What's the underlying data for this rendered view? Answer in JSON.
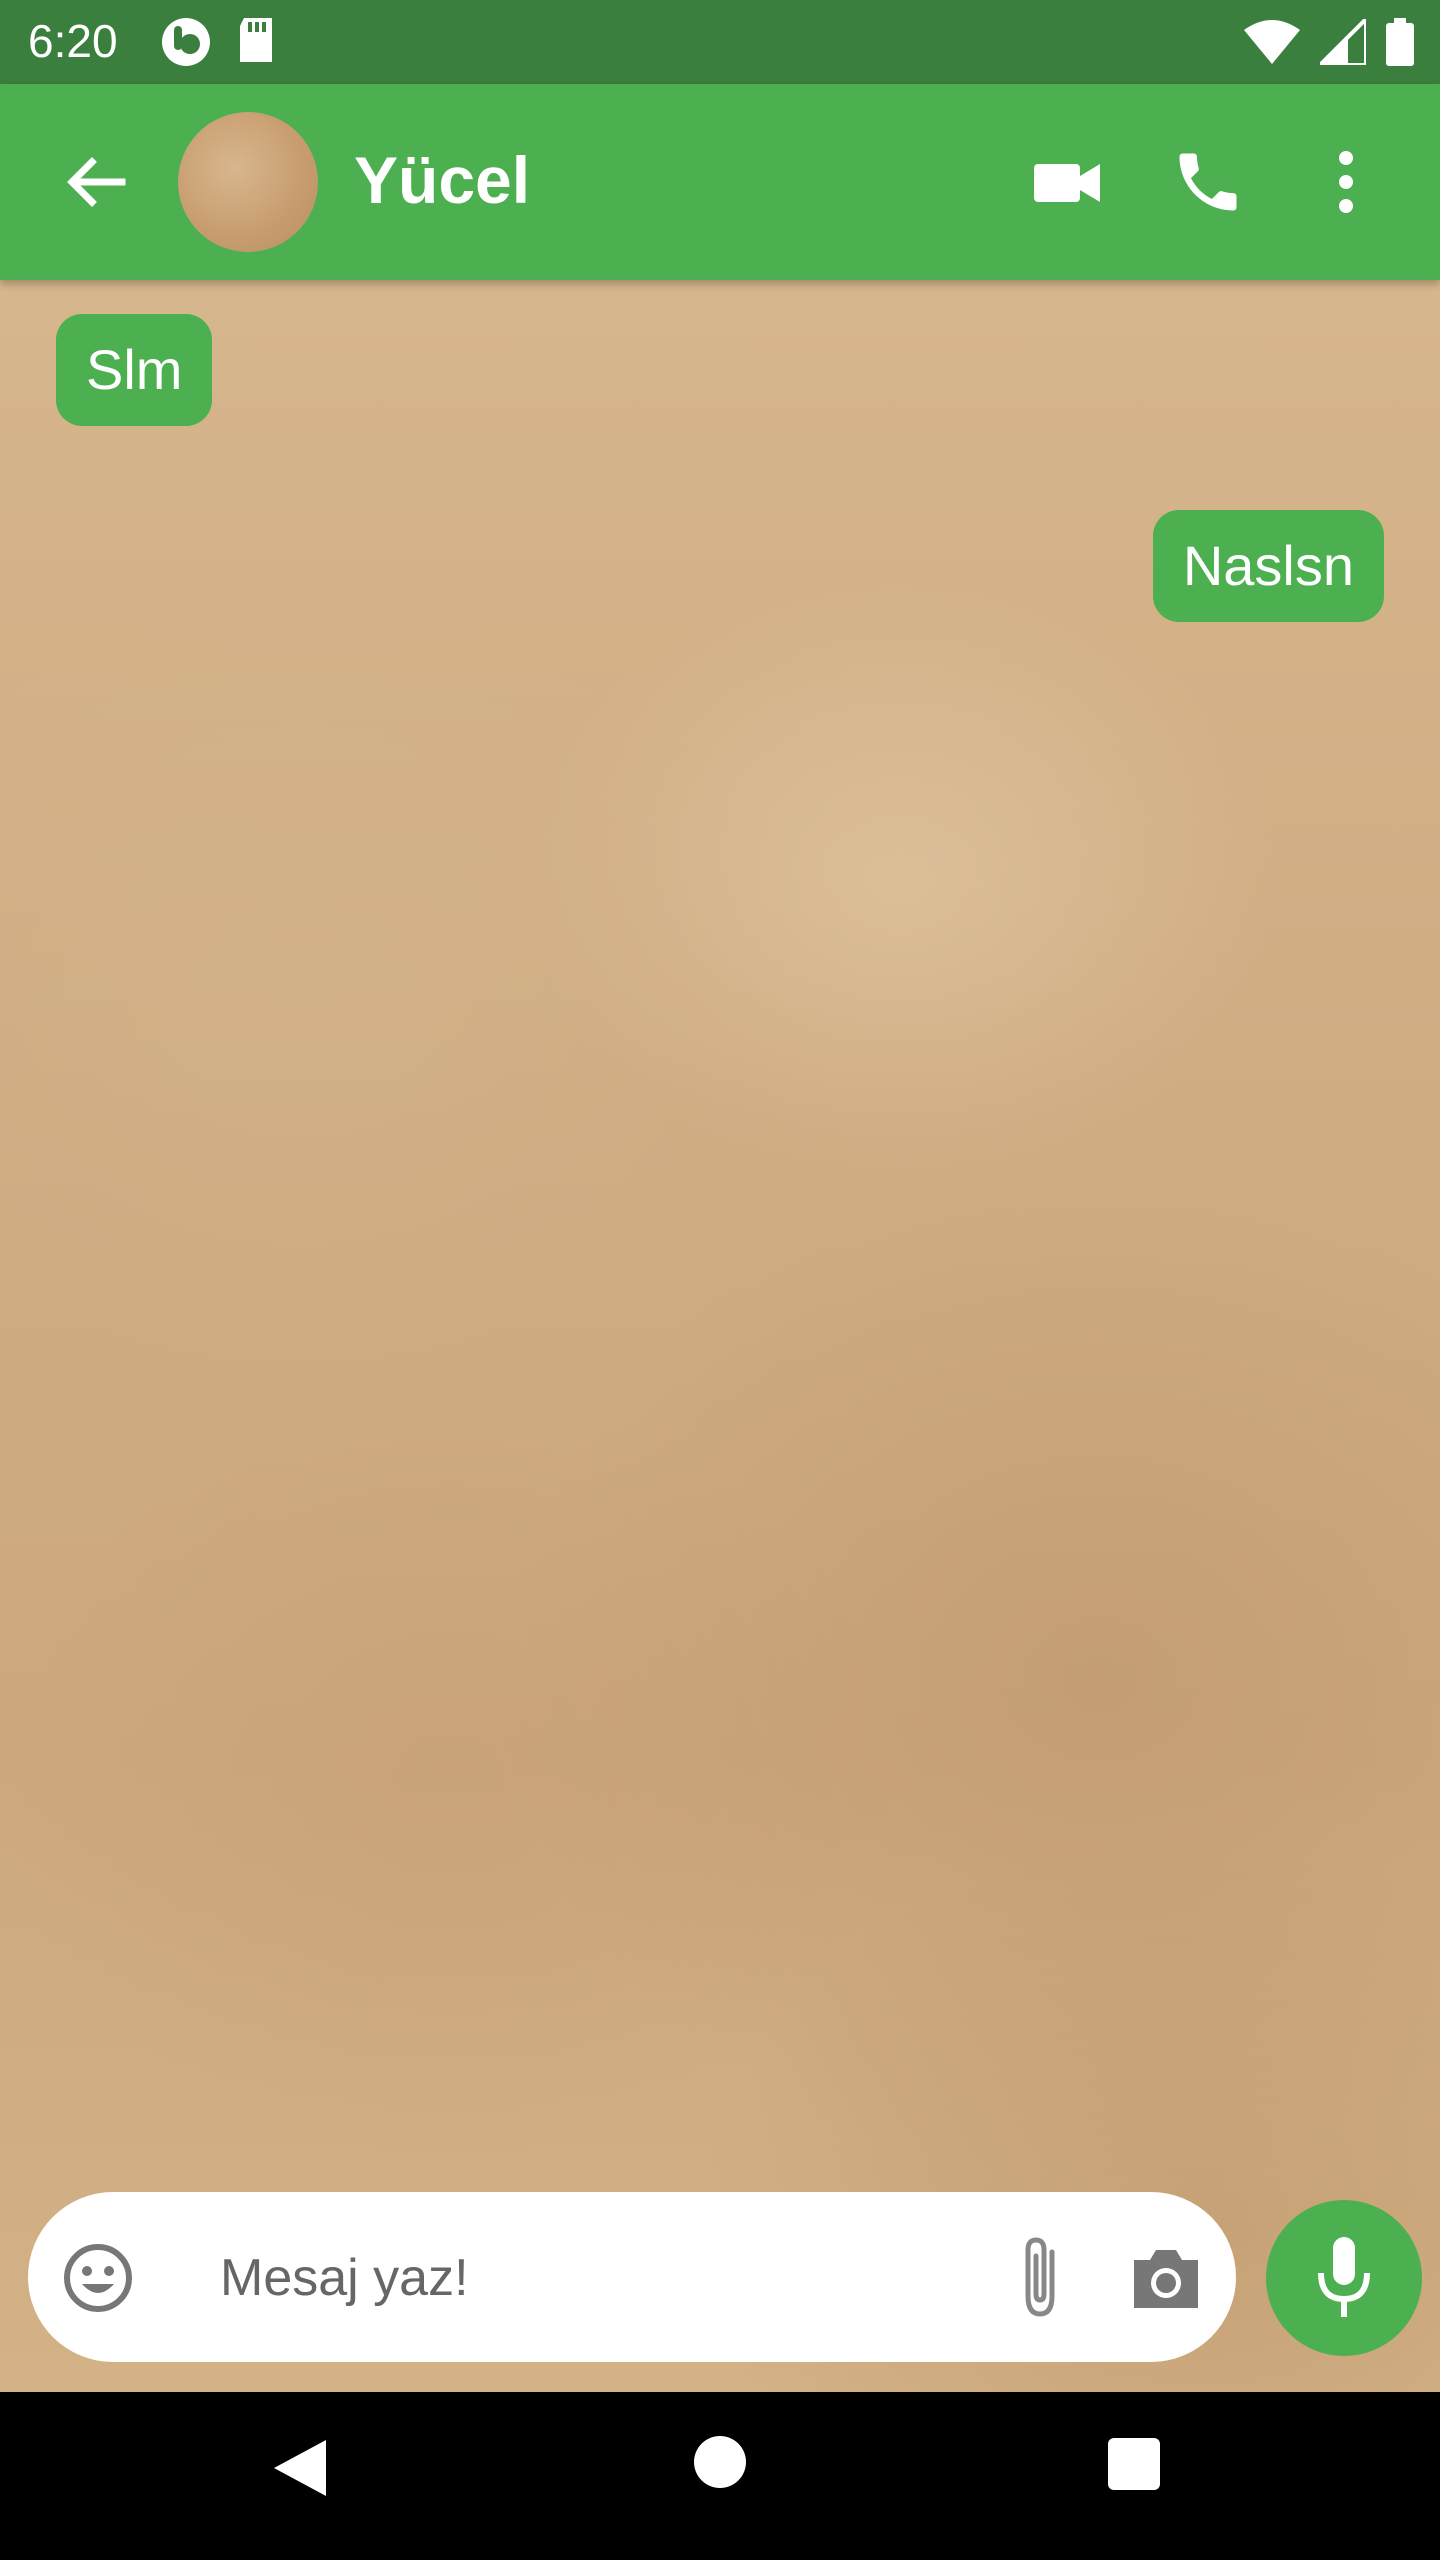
{
  "status_bar": {
    "time": "6:20",
    "icons": [
      "notification-app-icon",
      "sd-card-icon",
      "wifi-icon",
      "signal-icon",
      "battery-icon"
    ]
  },
  "app_bar": {
    "contact_name": "Yücel",
    "actions": [
      "back-arrow-icon",
      "video-call-icon",
      "phone-icon",
      "more-vert-icon"
    ],
    "color": "#4caf50"
  },
  "messages": [
    {
      "text": "Slm",
      "direction": "incoming"
    },
    {
      "text": "Naslsn",
      "direction": "outgoing"
    }
  ],
  "composer": {
    "placeholder": "Mesaj yaz!",
    "value": "",
    "icons": [
      "emoji-icon",
      "attach-icon",
      "camera-icon",
      "mic-icon"
    ]
  },
  "nav_bar": {
    "icons": [
      "nav-back-icon",
      "nav-home-icon",
      "nav-recents-icon"
    ]
  },
  "colors": {
    "primary": "#4caf50",
    "status_bar": "#3b7f3e",
    "background_texture": "#d3b287"
  }
}
